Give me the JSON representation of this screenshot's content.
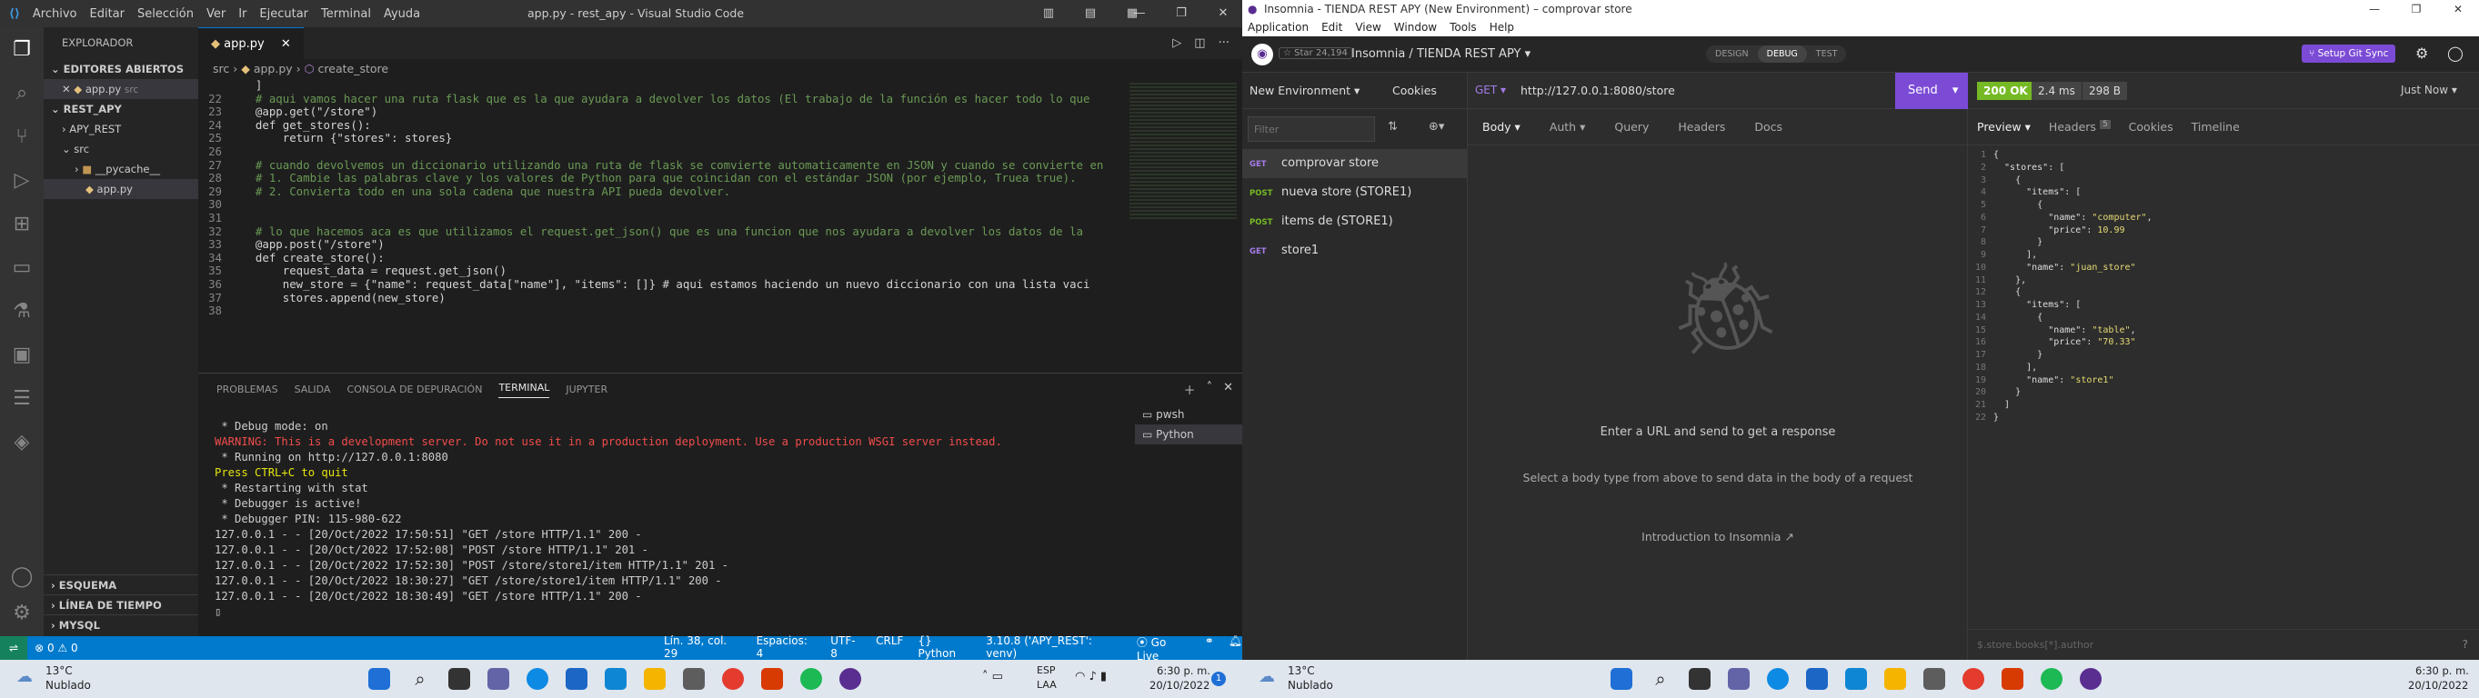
{
  "vscode": {
    "menu": [
      "Archivo",
      "Editar",
      "Selección",
      "Ver",
      "Ir",
      "Ejecutar",
      "Terminal",
      "Ayuda"
    ],
    "window_title": "app.py - rest_apy - Visual Studio Code",
    "explorer": {
      "title": "EXPLORADOR",
      "open_editors_label": "EDITORES ABIERTOS",
      "open_file": "app.py",
      "open_file_dir": "src",
      "project": "REST_APY",
      "tree": [
        "APY_REST",
        "src",
        "__pycache__",
        "app.py"
      ],
      "bottom_sections": [
        "ESQUEMA",
        "LÍNEA DE TIEMPO",
        "MYSQL"
      ]
    },
    "tab_label": "app.py",
    "breadcrumb": [
      "src",
      "app.py",
      "create_store"
    ],
    "code": [
      {
        "n": "",
        "t": "  ]",
        "c": ""
      },
      {
        "n": "22",
        "t": "  # aqui vamos hacer una ruta flask que es la que ayudara a devolver los datos (El trabajo de la función es hacer todo lo que",
        "c": "c-com"
      },
      {
        "n": "23",
        "t": "  @app.get(\"/store\")",
        "c": ""
      },
      {
        "n": "24",
        "t": "  def get_stores():",
        "c": ""
      },
      {
        "n": "25",
        "t": "      return {\"stores\": stores}",
        "c": ""
      },
      {
        "n": "26",
        "t": "",
        "c": ""
      },
      {
        "n": "27",
        "t": "  # cuando devolvemos un diccionario utilizando una ruta de flask se comvierte automaticamente en JSON y cuando se convierte en",
        "c": "c-com"
      },
      {
        "n": "28",
        "t": "  # 1. Cambie las palabras clave y los valores de Python para que coincidan con el estándar JSON (por ejemplo, Truea true).",
        "c": "c-com"
      },
      {
        "n": "29",
        "t": "  # 2. Convierta todo en una sola cadena que nuestra API pueda devolver.",
        "c": "c-com"
      },
      {
        "n": "30",
        "t": "",
        "c": ""
      },
      {
        "n": "31",
        "t": "",
        "c": ""
      },
      {
        "n": "32",
        "t": "  # lo que hacemos aca es que utilizamos el request.get_json() que es una funcion que nos ayudara a devolver los datos de la",
        "c": "c-com"
      },
      {
        "n": "33",
        "t": "  @app.post(\"/store\")",
        "c": ""
      },
      {
        "n": "34",
        "t": "  def create_store():",
        "c": ""
      },
      {
        "n": "35",
        "t": "      request_data = request.get_json()",
        "c": ""
      },
      {
        "n": "36",
        "t": "      new_store = {\"name\": request_data[\"name\"], \"items\": []} # aqui estamos haciendo un nuevo diccionario con una lista vaci",
        "c": ""
      },
      {
        "n": "37",
        "t": "      stores.append(new_store)",
        "c": ""
      },
      {
        "n": "38",
        "t": "",
        "c": ""
      }
    ],
    "panel_tabs": [
      "PROBLEMAS",
      "SALIDA",
      "CONSOLA DE DEPURACIÓN",
      "TERMINAL",
      "JUPYTER"
    ],
    "terminal": [
      {
        "t": " * Debug mode: on",
        "c": "#ccc"
      },
      {
        "t": "WARNING: This is a development server. Do not use it in a production deployment. Use a production WSGI server instead.",
        "c": "#f14c4c"
      },
      {
        "t": " * Running on http://127.0.0.1:8080",
        "c": "#ccc"
      },
      {
        "t": "Press CTRL+C to quit",
        "c": "#e5e510"
      },
      {
        "t": " * Restarting with stat",
        "c": "#ccc"
      },
      {
        "t": " * Debugger is active!",
        "c": "#ccc"
      },
      {
        "t": " * Debugger PIN: 115-980-622",
        "c": "#ccc"
      },
      {
        "t": "127.0.0.1 - - [20/Oct/2022 17:50:51] \"GET /store HTTP/1.1\" 200 -",
        "c": "#ccc"
      },
      {
        "t": "127.0.0.1 - - [20/Oct/2022 17:52:08] \"POST /store HTTP/1.1\" 201 -",
        "c": "#ccc"
      },
      {
        "t": "127.0.0.1 - - [20/Oct/2022 17:52:30] \"POST /store/store1/item HTTP/1.1\" 201 -",
        "c": "#ccc"
      },
      {
        "t": "127.0.0.1 - - [20/Oct/2022 18:30:27] \"GET /store/store1/item HTTP/1.1\" 200 -",
        "c": "#ccc"
      },
      {
        "t": "127.0.0.1 - - [20/Oct/2022 18:30:49] \"GET /store HTTP/1.1\" 200 -",
        "c": "#ccc"
      }
    ],
    "terminal_list": [
      "pwsh",
      "Python"
    ],
    "status": {
      "errors": "0",
      "warnings": "0",
      "position": "Lín. 38, col. 29",
      "spaces": "Espacios: 4",
      "encoding": "UTF-8",
      "eol": "CRLF",
      "language": "Python",
      "interpreter": "3.10.8 ('APY_REST': venv)",
      "golive": "Go Live"
    }
  },
  "taskbar": {
    "weather_temp": "13°C",
    "weather_desc": "Nublado",
    "lang": "ESP",
    "lang2": "LAA",
    "time": "6:30 p. m.",
    "date": "20/10/2022"
  },
  "insomnia": {
    "window_title": "Insomnia - TIENDA REST APY (New Environment) – comprovar store",
    "menu": [
      "Application",
      "Edit",
      "View",
      "Window",
      "Tools",
      "Help"
    ],
    "star_label": "Star",
    "star_count": "24,194",
    "breadcrumb_app": "Insomnia",
    "breadcrumb_sep": "/",
    "project": "TIENDA REST APY",
    "mode_tabs": [
      "DESIGN",
      "DEBUG",
      "TEST"
    ],
    "git_sync": "Setup Git Sync",
    "environment": "New Environment",
    "cookies": "Cookies",
    "filter_placeholder": "Filter",
    "requests": [
      {
        "method": "GET",
        "name": "comprovar store",
        "color": "#a47de8"
      },
      {
        "method": "POST",
        "name": "nueva store (STORE1)",
        "color": "#75ba24"
      },
      {
        "method": "POST",
        "name": "items de (STORE1)",
        "color": "#75ba24"
      },
      {
        "method": "GET",
        "name": "store1",
        "color": "#a47de8"
      }
    ],
    "url_method": "GET",
    "url": "http://127.0.0.1:8080/store",
    "send": "Send",
    "req_tabs": [
      "Body",
      "Auth",
      "Query",
      "Headers",
      "Docs"
    ],
    "empty_title": "Enter a URL and send to get a response",
    "empty_sub": "Select a body type from above to send data in the body of a request",
    "intro_link": "Introduction to Insomnia",
    "status_code": "200 OK",
    "time": "2.4 ms",
    "size": "298 B",
    "when": "Just Now",
    "resp_tabs": [
      "Preview",
      "Headers",
      "Cookies",
      "Timeline"
    ],
    "headers_count": "5",
    "json_lines": [
      [
        {
          "t": "{",
          "c": "jk"
        }
      ],
      [
        {
          "t": "  \"stores\": [",
          "c": "jk"
        }
      ],
      [
        {
          "t": "    {",
          "c": "jk"
        }
      ],
      [
        {
          "t": "      \"items\": [",
          "c": "jk"
        }
      ],
      [
        {
          "t": "        {",
          "c": "jk"
        }
      ],
      [
        {
          "t": "          \"name\": ",
          "c": "jk"
        },
        {
          "t": "\"computer\"",
          "c": "js"
        },
        {
          "t": ",",
          "c": "jk"
        }
      ],
      [
        {
          "t": "          \"price\": ",
          "c": "jk"
        },
        {
          "t": "10.99",
          "c": "js"
        }
      ],
      [
        {
          "t": "        }",
          "c": "jk"
        }
      ],
      [
        {
          "t": "      ],",
          "c": "jk"
        }
      ],
      [
        {
          "t": "      \"name\": ",
          "c": "jk"
        },
        {
          "t": "\"juan_store\"",
          "c": "js"
        }
      ],
      [
        {
          "t": "    },",
          "c": "jk"
        }
      ],
      [
        {
          "t": "    {",
          "c": "jk"
        }
      ],
      [
        {
          "t": "      \"items\": [",
          "c": "jk"
        }
      ],
      [
        {
          "t": "        {",
          "c": "jk"
        }
      ],
      [
        {
          "t": "          \"name\": ",
          "c": "jk"
        },
        {
          "t": "\"table\"",
          "c": "js"
        },
        {
          "t": ",",
          "c": "jk"
        }
      ],
      [
        {
          "t": "          \"price\": ",
          "c": "jk"
        },
        {
          "t": "\"70.33\"",
          "c": "js"
        }
      ],
      [
        {
          "t": "        }",
          "c": "jk"
        }
      ],
      [
        {
          "t": "      ],",
          "c": "jk"
        }
      ],
      [
        {
          "t": "      \"name\": ",
          "c": "jk"
        },
        {
          "t": "\"store1\"",
          "c": "js"
        }
      ],
      [
        {
          "t": "    }",
          "c": "jk"
        }
      ],
      [
        {
          "t": "  ]",
          "c": "jk"
        }
      ],
      [
        {
          "t": "}",
          "c": "jk"
        }
      ]
    ],
    "filter_expr": "$.store.books[*].author"
  }
}
